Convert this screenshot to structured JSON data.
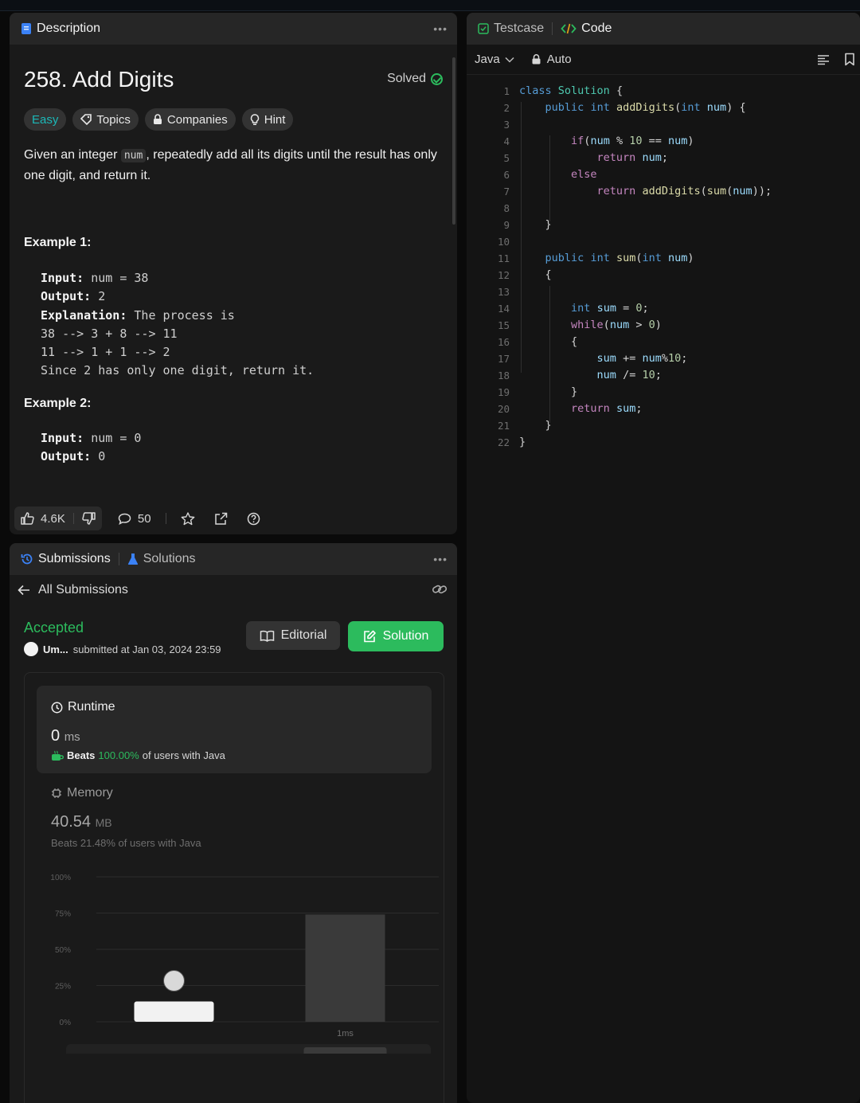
{
  "description": {
    "tab_label": "Description",
    "problem_title": "258. Add Digits",
    "status": "Solved",
    "tags": {
      "difficulty": "Easy",
      "topics": "Topics",
      "companies": "Companies",
      "hint": "Hint"
    },
    "statement_pre": "Given an integer ",
    "statement_code": "num",
    "statement_post": ", repeatedly add all its digits until the result has only one digit, and return it.",
    "example1": {
      "title": "Example 1:",
      "input_label": "Input:",
      "input_value": " num = 38",
      "output_label": "Output:",
      "output_value": " 2",
      "explanation_label": "Explanation:",
      "explanation_value": " The process is",
      "lines": [
        "38 --> 3 + 8 --> 11",
        "11 --> 1 + 1 --> 2",
        "Since 2 has only one digit, return it."
      ]
    },
    "example2": {
      "title": "Example 2:",
      "input_label": "Input:",
      "input_value": " num = 0",
      "output_label": "Output:",
      "output_value": " 0"
    },
    "footer": {
      "likes": "4.6K",
      "comments": "50"
    }
  },
  "submissions": {
    "tab_label": "Submissions",
    "solutions_label": "Solutions",
    "back_label": "All Submissions",
    "status": "Accepted",
    "user": "Um...",
    "submitted_text": "submitted at Jan 03, 2024 23:59",
    "editorial_label": "Editorial",
    "solution_label": "Solution",
    "runtime": {
      "title": "Runtime",
      "value": "0",
      "unit": "ms",
      "beats_label": "Beats",
      "beats_value": "100.00%",
      "beats_suffix": "of users with Java"
    },
    "memory": {
      "title": "Memory",
      "value": "40.54",
      "unit": "MB",
      "beats_text": "Beats 21.48% of users with Java"
    }
  },
  "chart_data": {
    "type": "bar",
    "y_ticks": [
      "100%",
      "75%",
      "50%",
      "25%",
      "0%"
    ],
    "ylim": [
      0,
      100
    ],
    "bars": [
      {
        "value": 14,
        "label": ""
      },
      {
        "value": 74,
        "label": "1ms"
      }
    ],
    "colors": {
      "user_bar": "#f2f2f2",
      "other_bar": "#3a3a3a"
    },
    "minimap_label": "1ms"
  },
  "code_panel": {
    "testcase_label": "Testcase",
    "code_label": "Code",
    "language": "Java",
    "mode": "Auto",
    "line_numbers": [
      "1",
      "2",
      "3",
      "4",
      "5",
      "6",
      "7",
      "8",
      "9",
      "10",
      "11",
      "12",
      "13",
      "14",
      "15",
      "16",
      "17",
      "18",
      "19",
      "20",
      "21",
      "22"
    ]
  },
  "colors": {
    "accent_green": "#2cbb5d",
    "easy_teal": "#1cb8b8",
    "panel_bg": "#1a1a1a",
    "header_bg": "#262626"
  }
}
